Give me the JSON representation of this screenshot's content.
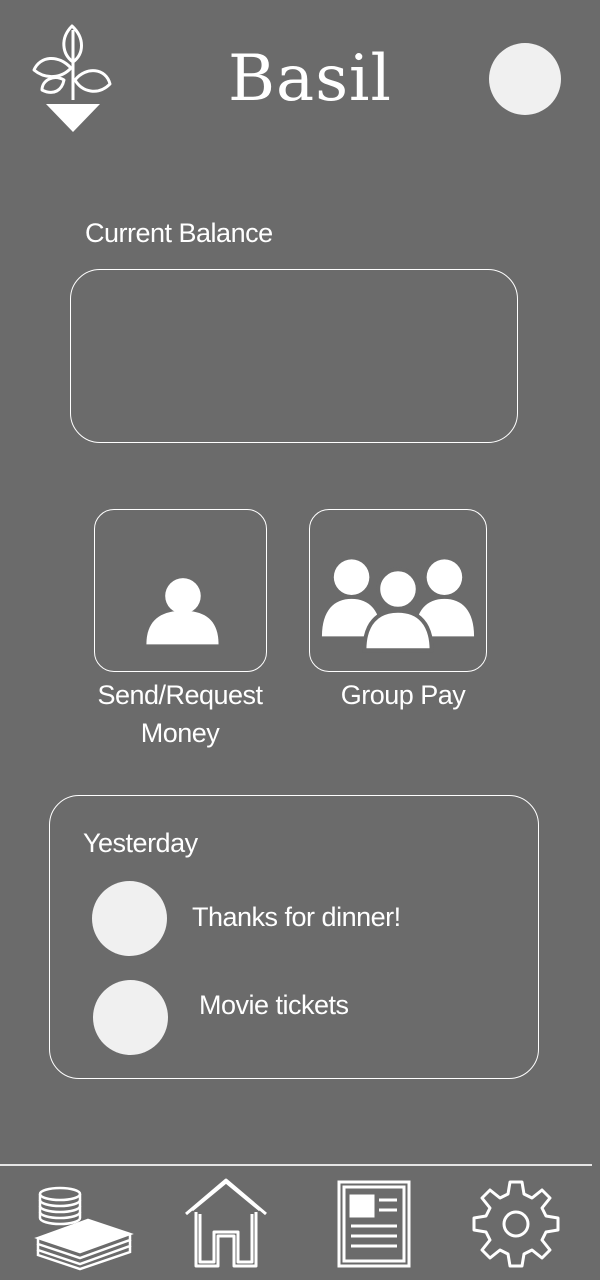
{
  "header": {
    "title": "Basil",
    "logo_icon": "plant-logo-icon",
    "avatar_icon": "profile-avatar"
  },
  "balance": {
    "label": "Current Balance",
    "amount": ""
  },
  "actions": {
    "send_request_line1": "Send/Request",
    "send_request_line2": "Money",
    "send_request_icon": "person-icon",
    "group_pay": "Group Pay",
    "group_pay_icon": "group-icon"
  },
  "activity": {
    "heading": "Yesterday",
    "items": [
      {
        "label": "Thanks for dinner!"
      },
      {
        "label": "Movie tickets"
      }
    ]
  },
  "nav": {
    "items": [
      "money-icon",
      "home-icon",
      "news-icon",
      "gear-icon"
    ]
  },
  "colors": {
    "background": "#6b6b6b",
    "foreground": "#ffffff",
    "avatar_fill": "#f0f0f0"
  }
}
